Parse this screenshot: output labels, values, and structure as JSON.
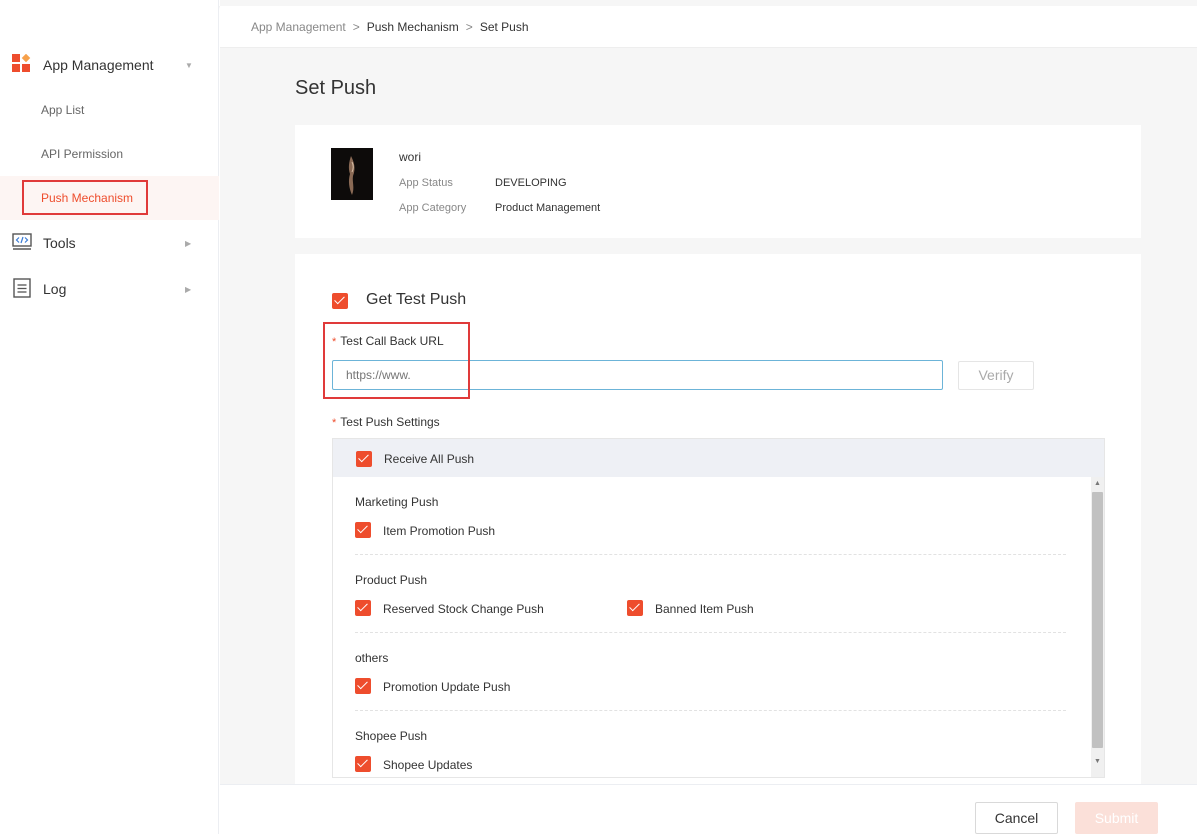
{
  "colors": {
    "accent": "#ee4d2d",
    "highlight": "#e03a3a",
    "input_focus": "#6cb4d8"
  },
  "breadcrumb": {
    "items": [
      "App Management",
      "Push Mechanism",
      "Set Push"
    ],
    "separator": ">"
  },
  "sidebar": {
    "sections": [
      {
        "label": "App Management",
        "icon": "grid-icon",
        "expanded": true,
        "children": [
          {
            "label": "App List"
          },
          {
            "label": "API Permission"
          },
          {
            "label": "Push Mechanism",
            "active": true
          }
        ]
      },
      {
        "label": "Tools",
        "icon": "code-icon"
      },
      {
        "label": "Log",
        "icon": "document-icon"
      }
    ]
  },
  "page": {
    "title": "Set Push"
  },
  "app": {
    "name": "wori",
    "status_label": "App Status",
    "status": "DEVELOPING",
    "category_label": "App Category",
    "category": "Product Management"
  },
  "form": {
    "get_test_push": {
      "label": "Get Test Push",
      "checked": true
    },
    "callback": {
      "label": "Test Call Back URL",
      "required_mark": "*",
      "placeholder": "https://www.",
      "verify_label": "Verify"
    },
    "settings": {
      "label": "Test Push Settings",
      "required_mark": "*",
      "receive_all": {
        "label": "Receive All Push",
        "checked": true
      },
      "groups": [
        {
          "title": "Marketing Push",
          "options": [
            {
              "label": "Item Promotion Push",
              "checked": true
            }
          ]
        },
        {
          "title": "Product Push",
          "options": [
            {
              "label": "Reserved Stock Change Push",
              "checked": true
            },
            {
              "label": "Banned Item Push",
              "checked": true
            }
          ]
        },
        {
          "title": "others",
          "options": [
            {
              "label": "Promotion Update Push",
              "checked": true
            }
          ]
        },
        {
          "title": "Shopee Push",
          "options": [
            {
              "label": "Shopee Updates",
              "checked": true
            }
          ]
        }
      ]
    }
  },
  "footer": {
    "cancel_label": "Cancel",
    "submit_label": "Submit"
  }
}
